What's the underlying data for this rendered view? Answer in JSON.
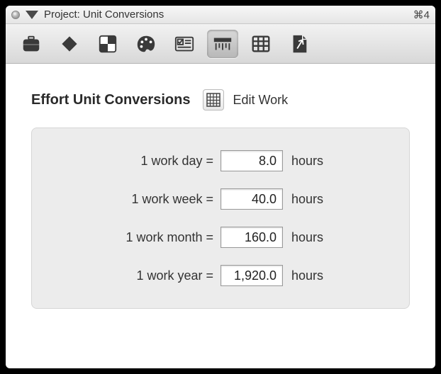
{
  "titlebar": {
    "title": "Project: Unit Conversions",
    "shortcut": "⌘4"
  },
  "section": {
    "title": "Effort Unit Conversions",
    "edit_label": "Edit Work"
  },
  "rows": [
    {
      "label": "1 work day =",
      "value": "8.0",
      "unit": "hours"
    },
    {
      "label": "1 work week =",
      "value": "40.0",
      "unit": "hours"
    },
    {
      "label": "1 work month =",
      "value": "160.0",
      "unit": "hours"
    },
    {
      "label": "1 work year =",
      "value": "1,920.0",
      "unit": "hours"
    }
  ]
}
